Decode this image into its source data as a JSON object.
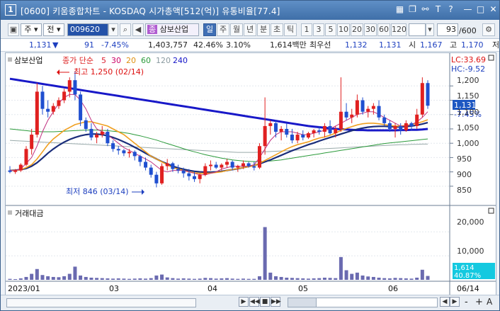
{
  "window": {
    "num": "1",
    "title": "[0600] 키움종합차트 - KOSDAQ 시가총액[512(억)] 유통비율[77.4]"
  },
  "toolbar": {
    "code": "009620",
    "name": "삼보산업",
    "gu": "주",
    "jeon": "전",
    "jong": "종",
    "periods": [
      "일",
      "주",
      "월",
      "년",
      "분",
      "초",
      "틱"
    ],
    "minutes": [
      "1",
      "3",
      "5",
      "10",
      "20",
      "30",
      "60",
      "120"
    ],
    "count": "93",
    "total": "/600"
  },
  "quote": {
    "price": "1,131",
    "arrow": "▼",
    "change": "91",
    "rate": "-7.45%",
    "volume": "1,403,757",
    "turnover": "42.46%",
    "vol_rate": "3.10%",
    "amount": "1,614백만",
    "bid_label": "최우선",
    "bid": "1,132",
    "ask": "1,131",
    "open_label": "시",
    "open": "1,167",
    "high_label": "고",
    "high": "1,170",
    "low_label": "저"
  },
  "chart": {
    "legend": {
      "name": "삼보산업",
      "ma_label": "종가 단순",
      "periods": [
        "5",
        "30",
        "20",
        "60",
        "120",
        "240"
      ],
      "colors": [
        "#d23",
        "#c06",
        "#f0a020",
        "#2a9a3a",
        "#9aa",
        "#1515c8"
      ]
    },
    "lc": "LC:33.69",
    "hc": "HC:-9.52",
    "high_note": "최고 1,250 (02/14)",
    "low_note": "최저 846 (03/14)",
    "yticks": [
      "1,200",
      "1,150",
      "1,100",
      "1,050",
      "1,000",
      "950",
      "900",
      "850"
    ],
    "last_price": "1,131",
    "last_rate": "-7.45%",
    "vol_title": "거래대금",
    "vol_ticks": [
      "20,000",
      "10,000"
    ],
    "vol_last": "1,614",
    "vol_rate": "40.87%",
    "xticks": [
      "2023/01",
      "03",
      "04",
      "05",
      "06"
    ],
    "x_last": "06/14"
  },
  "chart_data": {
    "type": "candlestick",
    "ylim": [
      820,
      1265
    ],
    "vol_ylim": [
      0,
      26000
    ],
    "candles": [
      [
        905,
        920,
        895,
        900
      ],
      [
        900,
        910,
        893,
        905
      ],
      [
        905,
        930,
        900,
        925
      ],
      [
        925,
        990,
        920,
        980
      ],
      [
        980,
        1050,
        960,
        1030
      ],
      [
        1030,
        1210,
        1020,
        1180
      ],
      [
        1180,
        1200,
        1100,
        1120
      ],
      [
        1120,
        1150,
        1090,
        1110
      ],
      [
        1110,
        1140,
        1100,
        1130
      ],
      [
        1130,
        1160,
        1120,
        1150
      ],
      [
        1150,
        1190,
        1140,
        1180
      ],
      [
        1180,
        1230,
        1160,
        1220
      ],
      [
        1220,
        1250,
        1150,
        1170
      ],
      [
        1170,
        1180,
        1060,
        1080
      ],
      [
        1080,
        1090,
        1040,
        1050
      ],
      [
        1050,
        1070,
        1010,
        1020
      ],
      [
        1020,
        1040,
        1000,
        1030
      ],
      [
        1030,
        1060,
        1020,
        1040
      ],
      [
        1040,
        1050,
        990,
        1000
      ],
      [
        1000,
        1010,
        970,
        980
      ],
      [
        980,
        990,
        960,
        975
      ],
      [
        975,
        980,
        955,
        965
      ],
      [
        965,
        980,
        950,
        970
      ],
      [
        970,
        975,
        940,
        955
      ],
      [
        955,
        960,
        920,
        935
      ],
      [
        935,
        950,
        905,
        915
      ],
      [
        915,
        925,
        880,
        890
      ],
      [
        890,
        900,
        846,
        860
      ],
      [
        860,
        930,
        855,
        920
      ],
      [
        920,
        945,
        905,
        930
      ],
      [
        930,
        935,
        900,
        910
      ],
      [
        910,
        925,
        895,
        905
      ],
      [
        905,
        915,
        880,
        895
      ],
      [
        895,
        910,
        870,
        885
      ],
      [
        885,
        900,
        865,
        875
      ],
      [
        875,
        895,
        860,
        890
      ],
      [
        890,
        930,
        885,
        920
      ],
      [
        920,
        940,
        905,
        925
      ],
      [
        925,
        935,
        910,
        915
      ],
      [
        915,
        930,
        905,
        925
      ],
      [
        925,
        945,
        915,
        935
      ],
      [
        935,
        940,
        905,
        915
      ],
      [
        915,
        925,
        900,
        920
      ],
      [
        920,
        940,
        910,
        930
      ],
      [
        930,
        935,
        915,
        920
      ],
      [
        920,
        935,
        905,
        915
      ],
      [
        915,
        1000,
        910,
        990
      ],
      [
        990,
        1160,
        960,
        1060
      ],
      [
        1060,
        1080,
        1030,
        1070
      ],
      [
        1070,
        1080,
        1020,
        1040
      ],
      [
        1040,
        1060,
        1010,
        1050
      ],
      [
        1050,
        1070,
        1020,
        1030
      ],
      [
        1030,
        1050,
        1000,
        1010
      ],
      [
        1010,
        1040,
        1000,
        1030
      ],
      [
        1030,
        1045,
        1010,
        1020
      ],
      [
        1020,
        1040,
        1015,
        1035
      ],
      [
        1035,
        1050,
        1020,
        1045
      ],
      [
        1045,
        1060,
        1030,
        1040
      ],
      [
        1040,
        1070,
        1020,
        1060
      ],
      [
        1060,
        1080,
        1030,
        1035
      ],
      [
        1035,
        1060,
        1020,
        1050
      ],
      [
        1050,
        1230,
        1040,
        1110
      ],
      [
        1110,
        1140,
        1080,
        1090
      ],
      [
        1090,
        1120,
        1070,
        1100
      ],
      [
        1100,
        1170,
        1090,
        1150
      ],
      [
        1150,
        1160,
        1100,
        1110
      ],
      [
        1110,
        1130,
        1090,
        1120
      ],
      [
        1120,
        1140,
        1100,
        1130
      ],
      [
        1130,
        1150,
        1080,
        1090
      ],
      [
        1090,
        1100,
        1060,
        1070
      ],
      [
        1070,
        1080,
        1040,
        1050
      ],
      [
        1050,
        1070,
        1020,
        1060
      ],
      [
        1060,
        1070,
        1030,
        1045
      ],
      [
        1045,
        1080,
        1040,
        1070
      ],
      [
        1070,
        1075,
        1045,
        1060
      ],
      [
        1060,
        1120,
        1050,
        1100
      ],
      [
        1100,
        1230,
        1090,
        1210
      ],
      [
        1210,
        1220,
        1120,
        1131
      ]
    ],
    "volumes": [
      400,
      300,
      600,
      1200,
      2500,
      4500,
      2000,
      1500,
      1200,
      1100,
      1500,
      2500,
      5500,
      1800,
      1200,
      900,
      800,
      700,
      600,
      500,
      600,
      500,
      400,
      500,
      600,
      500,
      700,
      1800,
      2200,
      1000,
      700,
      500,
      600,
      500,
      400,
      500,
      800,
      700,
      500,
      600,
      700,
      500,
      400,
      500,
      400,
      400,
      1500,
      22000,
      3000,
      1500,
      1200,
      900,
      800,
      700,
      600,
      500,
      600,
      700,
      900,
      800,
      700,
      9500,
      4000,
      2500,
      3000,
      1800,
      1400,
      1200,
      900,
      700,
      600,
      800,
      700,
      600,
      500,
      900,
      4200,
      1614
    ],
    "ma5": [
      905,
      905,
      910,
      930,
      950,
      990,
      1040,
      1080,
      1110,
      1140,
      1160,
      1170,
      1170,
      1150,
      1120,
      1080,
      1050,
      1040,
      1030,
      1015,
      1000,
      985,
      975,
      965,
      955,
      945,
      935,
      920,
      905,
      900,
      905,
      905,
      905,
      900,
      895,
      890,
      890,
      895,
      900,
      910,
      915,
      920,
      920,
      920,
      920,
      925,
      950,
      980,
      1010,
      1030,
      1040,
      1040,
      1040,
      1035,
      1030,
      1030,
      1035,
      1040,
      1045,
      1050,
      1060,
      1070,
      1080,
      1090,
      1100,
      1105,
      1110,
      1110,
      1100,
      1090,
      1080,
      1070,
      1060,
      1060,
      1065,
      1075,
      1090,
      1110
    ],
    "ma20": [
      905,
      905,
      908,
      915,
      925,
      945,
      970,
      995,
      1015,
      1030,
      1045,
      1055,
      1065,
      1070,
      1075,
      1075,
      1070,
      1065,
      1060,
      1050,
      1040,
      1030,
      1015,
      1000,
      985,
      970,
      955,
      945,
      935,
      925,
      915,
      910,
      905,
      900,
      897,
      895,
      895,
      896,
      898,
      900,
      905,
      908,
      912,
      915,
      918,
      922,
      930,
      940,
      950,
      960,
      970,
      980,
      988,
      995,
      1000,
      1005,
      1012,
      1018,
      1022,
      1028,
      1035,
      1045,
      1052,
      1058,
      1064,
      1068,
      1070,
      1070,
      1068,
      1065,
      1062,
      1060,
      1060,
      1062,
      1065,
      1070,
      1075,
      1082
    ],
    "ma30": [
      905,
      906,
      908,
      912,
      920,
      932,
      948,
      965,
      980,
      993,
      1004,
      1013,
      1020,
      1026,
      1030,
      1032,
      1032,
      1030,
      1026,
      1020,
      1013,
      1005,
      996,
      986,
      976,
      965,
      955,
      945,
      936,
      928,
      920,
      914,
      909,
      905,
      902,
      900,
      899,
      899,
      900,
      902,
      905,
      908,
      911,
      915,
      919,
      923,
      928,
      935,
      942,
      950,
      958,
      966,
      974,
      981,
      988,
      995,
      1001,
      1008,
      1014,
      1020,
      1026,
      1032,
      1038,
      1044,
      1049,
      1053,
      1056,
      1058,
      1059,
      1059,
      1058,
      1057,
      1057,
      1058,
      1060,
      1063,
      1067,
      1072
    ],
    "ma60": [
      1050,
      1048,
      1046,
      1044,
      1042,
      1041,
      1040,
      1040,
      1040,
      1041,
      1042,
      1043,
      1044,
      1045,
      1046,
      1046,
      1046,
      1045,
      1044,
      1042,
      1040,
      1037,
      1034,
      1030,
      1026,
      1021,
      1016,
      1011,
      1005,
      999,
      993,
      987,
      981,
      975,
      970,
      965,
      960,
      956,
      952,
      948,
      945,
      942,
      940,
      938,
      937,
      936,
      936,
      937,
      938,
      940,
      942,
      945,
      948,
      951,
      954,
      957,
      960,
      963,
      966,
      969,
      972,
      975,
      978,
      981,
      984,
      987,
      990,
      993,
      996,
      999,
      1001,
      1003,
      1005,
      1007,
      1009,
      1011,
      1013,
      1015
    ],
    "ma120": [
      1010,
      1009,
      1008,
      1007,
      1006,
      1005,
      1004,
      1003,
      1002,
      1001,
      1000,
      999,
      998,
      997,
      996,
      995,
      994,
      993,
      992,
      991,
      990,
      989,
      988,
      987,
      986,
      985,
      984,
      983,
      982,
      981,
      980,
      979,
      978,
      977,
      976,
      975,
      974,
      973,
      972,
      971,
      970,
      969,
      968,
      968,
      968,
      968,
      969,
      970,
      971,
      972,
      973,
      974,
      975,
      976,
      977,
      978,
      979,
      980,
      981,
      982,
      983,
      984,
      985,
      986,
      987,
      988,
      989,
      990,
      991,
      992,
      993,
      994,
      995,
      995,
      996,
      996,
      997,
      997
    ],
    "ma240": [
      1225,
      1222,
      1219,
      1216,
      1213,
      1210,
      1207,
      1204,
      1201,
      1198,
      1195,
      1192,
      1189,
      1186,
      1183,
      1180,
      1177,
      1174,
      1171,
      1168,
      1165,
      1162,
      1159,
      1156,
      1153,
      1150,
      1147,
      1144,
      1141,
      1138,
      1135,
      1132,
      1129,
      1126,
      1123,
      1120,
      1117,
      1114,
      1111,
      1108,
      1105,
      1102,
      1099,
      1096,
      1093,
      1090,
      1087,
      1084,
      1081,
      1078,
      1075,
      1072,
      1069,
      1066,
      1063,
      1060,
      1058,
      1056,
      1054,
      1052,
      1050,
      1049,
      1048,
      1047,
      1046,
      1046,
      1045,
      1045,
      1045,
      1045,
      1045,
      1045,
      1046,
      1046,
      1047,
      1047,
      1048,
      1050
    ]
  },
  "status": {
    "buttons": [
      "▶",
      "◀◀",
      "■",
      "▶▶"
    ],
    "zoom": [
      "-",
      "+",
      "A"
    ]
  }
}
